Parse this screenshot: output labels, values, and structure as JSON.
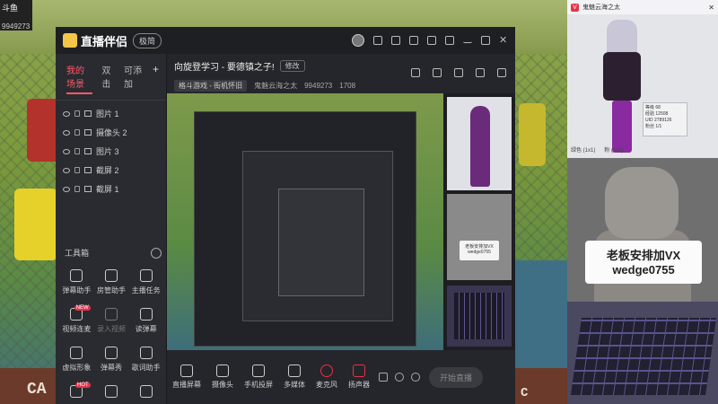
{
  "game": {
    "logo_text": "斗鱼",
    "room_number": "9949273",
    "bottom_text": "CA",
    "bottom_text_right": "C"
  },
  "app": {
    "name": "直播伴侣",
    "version_badge": "极简",
    "titlebar_icons": [
      "avatar-icon",
      "skin-icon",
      "message-icon",
      "download-icon",
      "shirt-icon",
      "settings-icon",
      "minimize-icon",
      "maximize-icon",
      "close-icon"
    ]
  },
  "sidebar": {
    "tabs": [
      "我的场景",
      "双击",
      "可添加"
    ],
    "add_label": "+",
    "sources": [
      {
        "label": "图片 1"
      },
      {
        "label": "摄像头 2"
      },
      {
        "label": "图片 3"
      },
      {
        "label": "截屏 2"
      },
      {
        "label": "截屏 1"
      }
    ],
    "toolbox_title": "工具箱",
    "tools": [
      {
        "label": "弹幕助手",
        "icon": "danmu-icon",
        "disabled": false,
        "badge": ""
      },
      {
        "label": "房管助手",
        "icon": "admin-icon",
        "disabled": false,
        "badge": ""
      },
      {
        "label": "主播任务",
        "icon": "task-icon",
        "disabled": false,
        "badge": ""
      },
      {
        "label": "视频连麦",
        "icon": "video-link-icon",
        "disabled": false,
        "badge": "NEW"
      },
      {
        "label": "录入视频",
        "icon": "record-icon",
        "disabled": true,
        "badge": ""
      },
      {
        "label": "读弹幕",
        "icon": "read-danmu-icon",
        "disabled": false,
        "badge": ""
      },
      {
        "label": "虚拟形象",
        "icon": "avatar-icon",
        "disabled": false,
        "badge": ""
      },
      {
        "label": "弹幕秀",
        "icon": "tv-icon",
        "disabled": false,
        "badge": ""
      },
      {
        "label": "歌词助手",
        "icon": "lyrics-icon",
        "disabled": false,
        "badge": ""
      },
      {
        "label": "",
        "icon": "gift-icon",
        "disabled": false,
        "badge": "HOT"
      },
      {
        "label": "",
        "icon": "download-icon",
        "disabled": false,
        "badge": ""
      },
      {
        "label": "",
        "icon": "game-icon",
        "disabled": false,
        "badge": ""
      }
    ]
  },
  "stream": {
    "title": "向旋登学习 - 要德镇之子!",
    "edit_label": "修改",
    "category": "格斗游戏 - 街机怀旧",
    "streamer_name": "鬼魅云海之太",
    "room_number": "9949273",
    "hot_value": "1708"
  },
  "bottom": {
    "items": [
      {
        "label": "直播屏幕",
        "icon": "screen-icon"
      },
      {
        "label": "摄像头",
        "icon": "camera-icon"
      },
      {
        "label": "手机投屏",
        "icon": "phone-icon"
      },
      {
        "label": "多媒体",
        "icon": "media-icon"
      },
      {
        "label": "麦克风",
        "icon": "mic-icon"
      },
      {
        "label": "扬声器",
        "icon": "speaker-icon"
      }
    ],
    "start_label": "开始直播"
  },
  "right_panel": {
    "header_name": "鬼魅云海之太",
    "stats_lines": [
      "等级 68",
      "经验 12508",
      "UID 2789126",
      "粉丝 1/1"
    ],
    "footer_items": [
      "绿色 (1x1)",
      "粉 (1x1)"
    ],
    "cat_sign_line1": "老板安排加VX",
    "cat_sign_line2": "wedge0755",
    "small_cat_sign": "老板安排加VX wedge0755"
  },
  "colors": {
    "accent": "#e6334a",
    "window_bg": "#25262b",
    "sidebar_bg": "#2a2b30",
    "titlebar_bg": "#1e1f23"
  }
}
